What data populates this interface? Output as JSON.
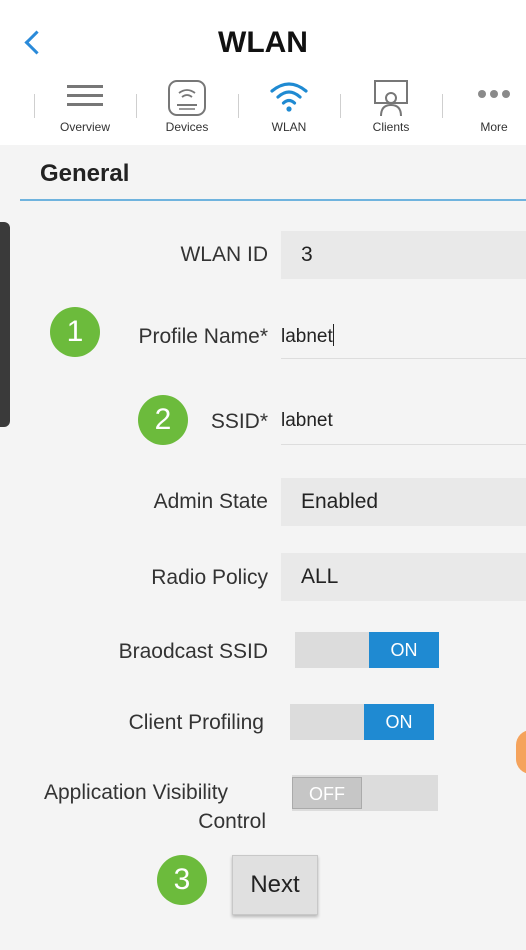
{
  "header": {
    "title": "WLAN"
  },
  "tabs": [
    {
      "label": "Overview",
      "icon": "menu-icon"
    },
    {
      "label": "Devices",
      "icon": "device-icon"
    },
    {
      "label": "WLAN",
      "icon": "wifi-icon",
      "active": true
    },
    {
      "label": "Clients",
      "icon": "clients-icon"
    },
    {
      "label": "More",
      "icon": "more-icon"
    }
  ],
  "section": {
    "title": "General"
  },
  "form": {
    "wlan_id": {
      "label": "WLAN ID",
      "value": "3"
    },
    "profile_name": {
      "label": "Profile Name*",
      "value": "labnet"
    },
    "ssid": {
      "label": "SSID*",
      "value": "labnet"
    },
    "admin_state": {
      "label": "Admin State",
      "value": "Enabled"
    },
    "radio_policy": {
      "label": "Radio Policy",
      "value": "ALL"
    },
    "broadcast_ssid": {
      "label": "Braodcast SSID",
      "state": "ON"
    },
    "client_profiling": {
      "label": "Client Profiling",
      "state": "ON"
    },
    "app_visibility": {
      "label_line1": "Application Visibility",
      "label_line2": "Control",
      "state": "OFF"
    }
  },
  "badges": {
    "one": "1",
    "two": "2",
    "three": "3"
  },
  "next_label": "Next",
  "colors": {
    "accent": "#2a8ad9",
    "toggle_on": "#1f8ad2",
    "badge": "#6cbb3c",
    "divider": "#6fb3de"
  }
}
